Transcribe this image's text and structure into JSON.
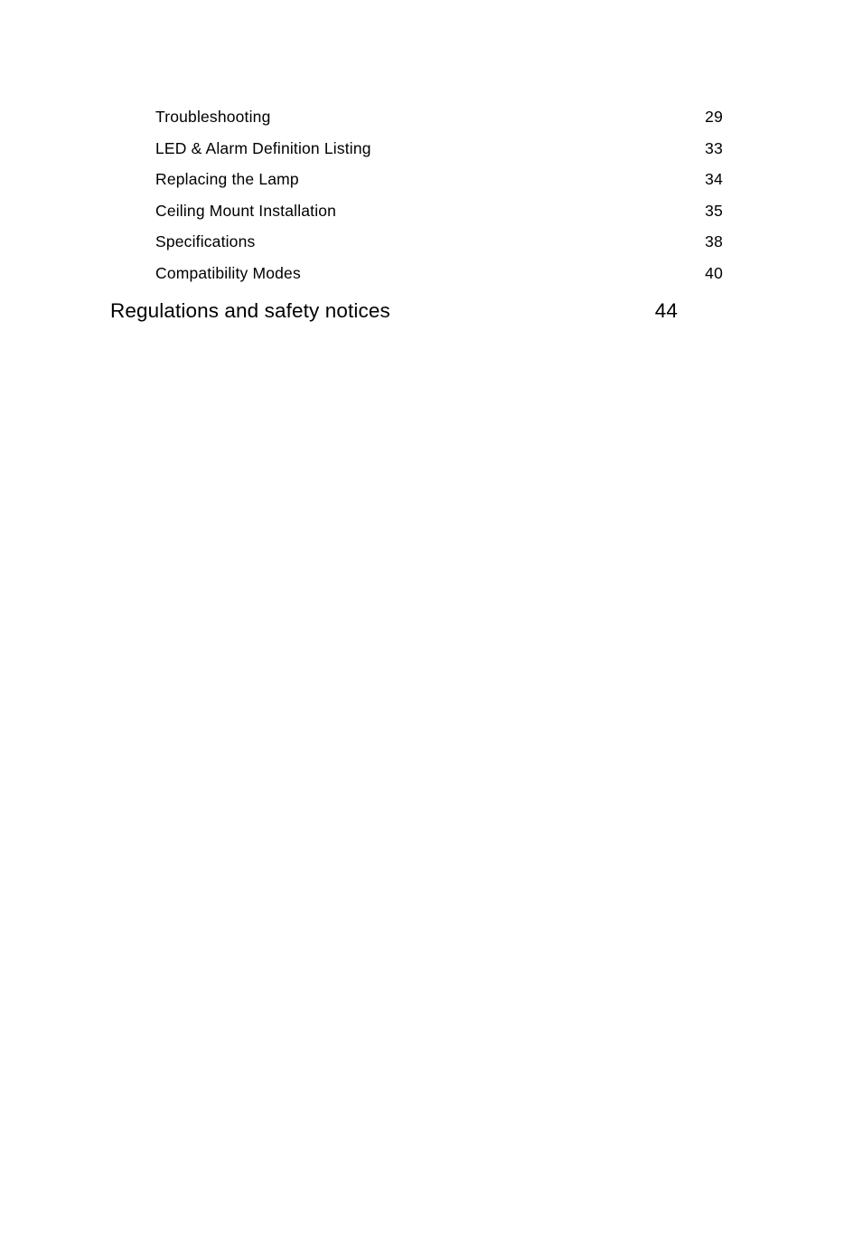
{
  "document": {
    "kind": "table-of-contents",
    "page_background": "#ffffff",
    "text_color": "#000000"
  },
  "toc": {
    "entries": [
      {
        "level": 2,
        "title": "Troubleshooting",
        "page": "29"
      },
      {
        "level": 2,
        "title": "LED & Alarm Definition Listing",
        "page": "33"
      },
      {
        "level": 2,
        "title": "Replacing the Lamp",
        "page": "34"
      },
      {
        "level": 2,
        "title": "Ceiling Mount Installation",
        "page": "35"
      },
      {
        "level": 2,
        "title": "Specifications",
        "page": "38"
      },
      {
        "level": 2,
        "title": "Compatibility Modes",
        "page": "40"
      },
      {
        "level": 1,
        "title": "Regulations and safety notices",
        "page": "44"
      }
    ]
  }
}
